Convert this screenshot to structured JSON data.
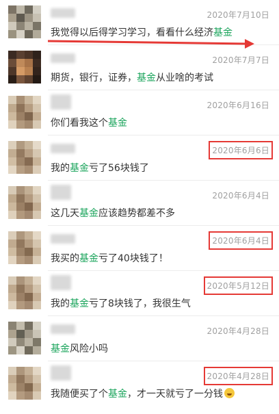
{
  "colors": {
    "keyword": "#1aa45b",
    "date": "#a0a0a0",
    "highlight_box": "#e53935",
    "arrow": "#e53935"
  },
  "messages": [
    {
      "date": "2020年7月10日",
      "parts": [
        "我觉得以后得学习学习，看看什么经济",
        "基金",
        ""
      ],
      "boxed": false
    },
    {
      "date": "2020年7月7日",
      "parts": [
        "期货，银行，证券，",
        "基金",
        "从业啥的考试"
      ],
      "boxed": false
    },
    {
      "date": "2020年6月16日",
      "parts": [
        "你们看我这个",
        "基金",
        ""
      ],
      "boxed": false
    },
    {
      "date": "2020年6月6日",
      "parts": [
        "我的",
        "基金",
        "亏了56块钱了"
      ],
      "boxed": true
    },
    {
      "date": "2020年6月4日",
      "parts": [
        "这几天",
        "基金",
        "应该趋势都差不多"
      ],
      "boxed": false
    },
    {
      "date": "2020年6月4日",
      "parts": [
        "我买的",
        "基金",
        "亏了40块钱了！"
      ],
      "boxed": true
    },
    {
      "date": "2020年5月12日",
      "parts": [
        "我的",
        "基金",
        "亏了8块钱了，我很生气"
      ],
      "boxed": true
    },
    {
      "date": "2020年4月28日",
      "parts": [
        "",
        "基金",
        "风险小吗"
      ],
      "boxed": false
    },
    {
      "date": "2020年4月28日",
      "parts": [
        "我随便买了个",
        "基金",
        "，才一天就亏了一分钱"
      ],
      "boxed": true,
      "emoji": "laughing-crying-emoji"
    }
  ]
}
